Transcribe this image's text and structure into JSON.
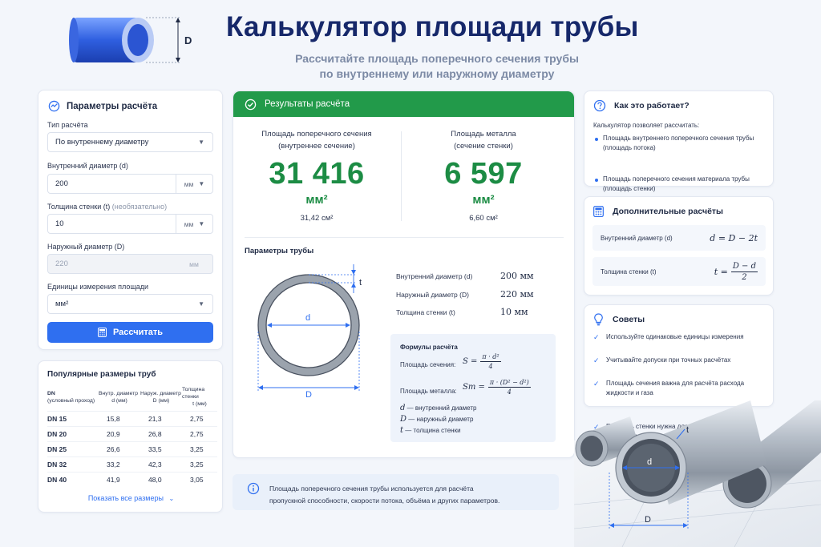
{
  "header": {
    "title": "Калькулятор площади трубы",
    "subtitle_line1": "Рассчитайте площадь поперечного сечения трубы",
    "subtitle_line2": "по внутреннему или наружному диаметру",
    "pipe_label": "D"
  },
  "params": {
    "title": "Параметры расчёта",
    "calc_type_label": "Тип расчёта",
    "calc_type_value": "По внутреннему диаметру",
    "inner_label": "Внутренний диаметр (d)",
    "inner_value": "200",
    "inner_unit": "мм",
    "wall_label": "Толщина стенки (t)",
    "wall_optional": "(необязательно)",
    "wall_value": "10",
    "wall_unit": "мм",
    "outer_label": "Наружный диаметр (D)",
    "outer_value": "220",
    "outer_unit": "мм",
    "area_unit_label": "Единицы измерения площади",
    "area_unit_value": "мм²",
    "calc_button": "Рассчитать"
  },
  "popular": {
    "title": "Популярные размеры труб",
    "headers": [
      {
        "h1": "DN",
        "h2": "(условный проход)"
      },
      {
        "h1": "Внутр. диаметр",
        "h2": "d (мм)"
      },
      {
        "h1": "Наруж. диаметр",
        "h2": "D (мм)"
      },
      {
        "h1": "Толщина стенки",
        "h2": "t (мм)"
      }
    ],
    "rows": [
      [
        "DN 15",
        "15,8",
        "21,3",
        "2,75"
      ],
      [
        "DN 20",
        "20,9",
        "26,8",
        "2,75"
      ],
      [
        "DN 25",
        "26,6",
        "33,5",
        "3,25"
      ],
      [
        "DN 32",
        "33,2",
        "42,3",
        "3,25"
      ],
      [
        "DN 40",
        "41,9",
        "48,0",
        "3,05"
      ]
    ],
    "show_all": "Показать все размеры"
  },
  "results": {
    "banner": "Результаты расчёта",
    "inner_cap1": "Площадь поперечного сечения",
    "inner_cap2": "(внутреннее сечение)",
    "inner_value": "31 416",
    "inner_unit": "мм²",
    "inner_alt": "31,42 см²",
    "metal_cap1": "Площадь металла",
    "metal_cap2": "(сечение стенки)",
    "metal_value": "6 597",
    "metal_unit": "мм²",
    "metal_alt": "6,60 см²",
    "pipe_params_title": "Параметры трубы",
    "diagram": {
      "d": "d",
      "D": "D",
      "t": "t"
    },
    "kv": [
      {
        "label": "Внутренний диаметр (d)",
        "value": "200 мм"
      },
      {
        "label": "Наружный диаметр (D)",
        "value": "220 мм"
      },
      {
        "label": "Толщина стенки (t)",
        "value": "10 мм"
      }
    ],
    "formulas_title": "Формулы расчёта",
    "formula_s_label": "Площадь сечения:",
    "formula_s_lhs": "S =",
    "formula_s_num": "π · d²",
    "formula_s_den": "4",
    "formula_m_label": "Площадь металла:",
    "formula_m_lhs": "Sm =",
    "formula_m_num": "π · (D² − d²)",
    "formula_m_den": "4",
    "legend": [
      {
        "sym": "d",
        "text": "— внутренний диаметр"
      },
      {
        "sym": "D",
        "text": "— наружный диаметр"
      },
      {
        "sym": "t",
        "text": "— толщина стенки"
      }
    ]
  },
  "info": {
    "line1": "Площадь поперечного сечения трубы используется для расчёта",
    "line2": "пропускной способности, скорости потока, объёма и других параметров."
  },
  "how": {
    "title": "Как это работает?",
    "intro": "Калькулятор позволяет рассчитать:",
    "items": [
      "Площадь внутреннего поперечного сечения трубы (площадь потока)",
      "Площадь поперечного сечения материала трубы (площадь стенки)"
    ]
  },
  "extra": {
    "title": "Дополнительные расчёты",
    "f1_label": "Внутренний диаметр (d)",
    "f1_expr": "d = D − 2t",
    "f2_label": "Толщина стенки (t)",
    "f2_lhs": "t =",
    "f2_num": "D − d",
    "f2_den": "2"
  },
  "tips": {
    "title": "Советы",
    "items": [
      "Используйте одинаковые единицы измерения",
      "Учитывайте допуски при точных расчётах",
      "Площадь сечения важна для расчёта расхода жидкости и газа",
      "Площадь стенки нужна для расчёта веса и прочности трубы"
    ]
  },
  "photo": {
    "d": "d",
    "D": "D",
    "t": "t"
  },
  "colors": {
    "accent": "#2f6ff0",
    "success": "#229a4a",
    "result_text": "#1c8c44",
    "title": "#16286a"
  }
}
